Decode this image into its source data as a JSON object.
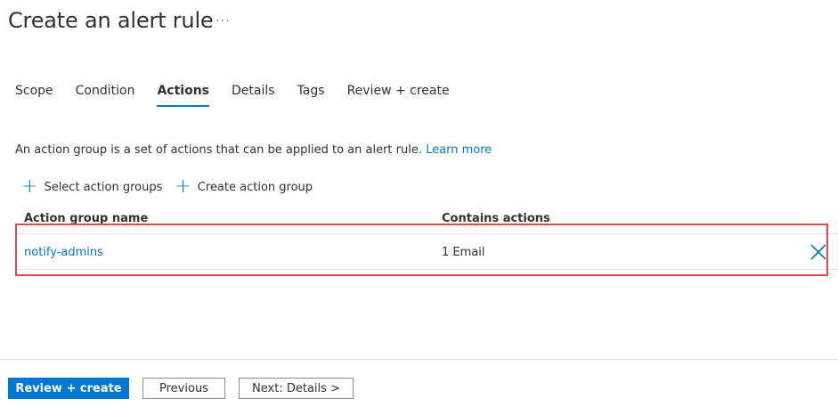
{
  "header": {
    "title": "Create an alert rule",
    "more": "···"
  },
  "tabs": [
    {
      "label": "Scope"
    },
    {
      "label": "Condition"
    },
    {
      "label": "Actions",
      "active": true
    },
    {
      "label": "Details"
    },
    {
      "label": "Tags"
    },
    {
      "label": "Review + create"
    }
  ],
  "description": {
    "text": "An action group is a set of actions that can be applied to an alert rule.",
    "link": "Learn more"
  },
  "commands": {
    "select_label": "Select action groups",
    "create_label": "Create action group"
  },
  "table": {
    "columns": [
      "Action group name",
      "Contains actions"
    ],
    "rows": [
      {
        "name": "notify-admins",
        "actions": "1 Email"
      }
    ]
  },
  "footer": {
    "review_label": "Review + create",
    "previous_label": "Previous",
    "next_label": "Next: Details >"
  },
  "colors": {
    "accent": "#0078d4",
    "highlight": "#e04b4f"
  }
}
